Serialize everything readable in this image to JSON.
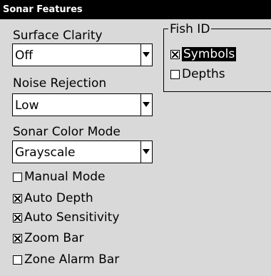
{
  "window": {
    "title": "Sonar Features"
  },
  "surface_clarity": {
    "label": "Surface Clarity",
    "value": "Off"
  },
  "noise_rejection": {
    "label": "Noise Rejection",
    "value": "Low"
  },
  "sonar_color_mode": {
    "label": "Sonar Color Mode",
    "value": "Grayscale"
  },
  "checkboxes": {
    "manual_mode": {
      "label": "Manual Mode",
      "checked": false
    },
    "auto_depth": {
      "label": "Auto Depth",
      "checked": true
    },
    "auto_sensitivity": {
      "label": "Auto Sensitivity",
      "checked": true
    },
    "zoom_bar": {
      "label": "Zoom Bar",
      "checked": true
    },
    "zone_alarm_bar": {
      "label": "Zone Alarm Bar",
      "checked": false
    }
  },
  "fish_id": {
    "title": "Fish ID",
    "symbols": {
      "label": "Symbols",
      "checked": true,
      "selected": true
    },
    "depths": {
      "label": "Depths",
      "checked": false
    }
  },
  "colors": {
    "background": "#d9d9d9",
    "titlebar": "#000000",
    "titlebar_text": "#ffffff",
    "field_bg": "#ffffff",
    "selection_bg": "#000000"
  }
}
